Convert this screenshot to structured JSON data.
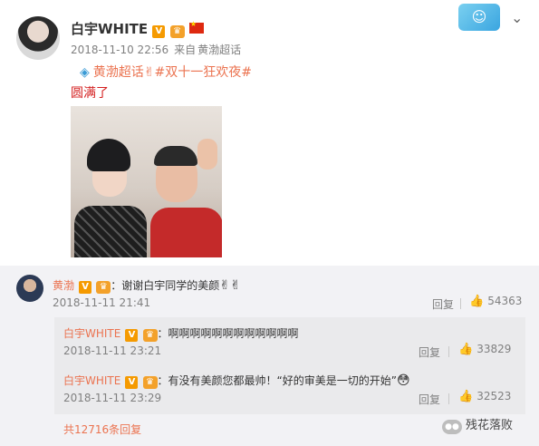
{
  "post": {
    "username": "白宇WHITE",
    "badge_v": "V",
    "timestamp": "2018-11-10 22:56",
    "source_prefix": "来自",
    "source": "黄渤超话",
    "topic_label": "黄渤超话",
    "topic_emoji": "✌",
    "hashtag": "#双十一狂欢夜#",
    "text": "圆满了"
  },
  "comment": {
    "username": "黄渤",
    "badge_v": "V",
    "text": "：谢谢白宇同学的美颜",
    "emoji": "✌✌",
    "timestamp": "2018-11-11 21:41",
    "reply_label": "回复",
    "likes": "54363"
  },
  "replies": [
    {
      "username": "白宇WHITE",
      "badge_v": "V",
      "text": "：啊啊啊啊啊啊啊啊啊啊啊啊",
      "timestamp": "2018-11-11 23:21",
      "reply_label": "回复",
      "likes": "33829"
    },
    {
      "username": "白宇WHITE",
      "badge_v": "V",
      "text": "：有没有美颜您都最帅！“好的审美是一切的开始”",
      "emoji": "😳",
      "timestamp": "2018-11-11 23:29",
      "reply_label": "回复",
      "likes": "32523"
    }
  ],
  "more_replies": "共12716条回复",
  "watermark": "残花落败",
  "icons": {
    "thumb": "thumbs-up-icon",
    "chevron": "chevron-down-icon",
    "topic": "eye-icon"
  },
  "colors": {
    "accent": "#eb7350",
    "text_red": "#d42020",
    "link_blue": "#3a9bd6",
    "panel_bg": "#f2f2f5"
  }
}
